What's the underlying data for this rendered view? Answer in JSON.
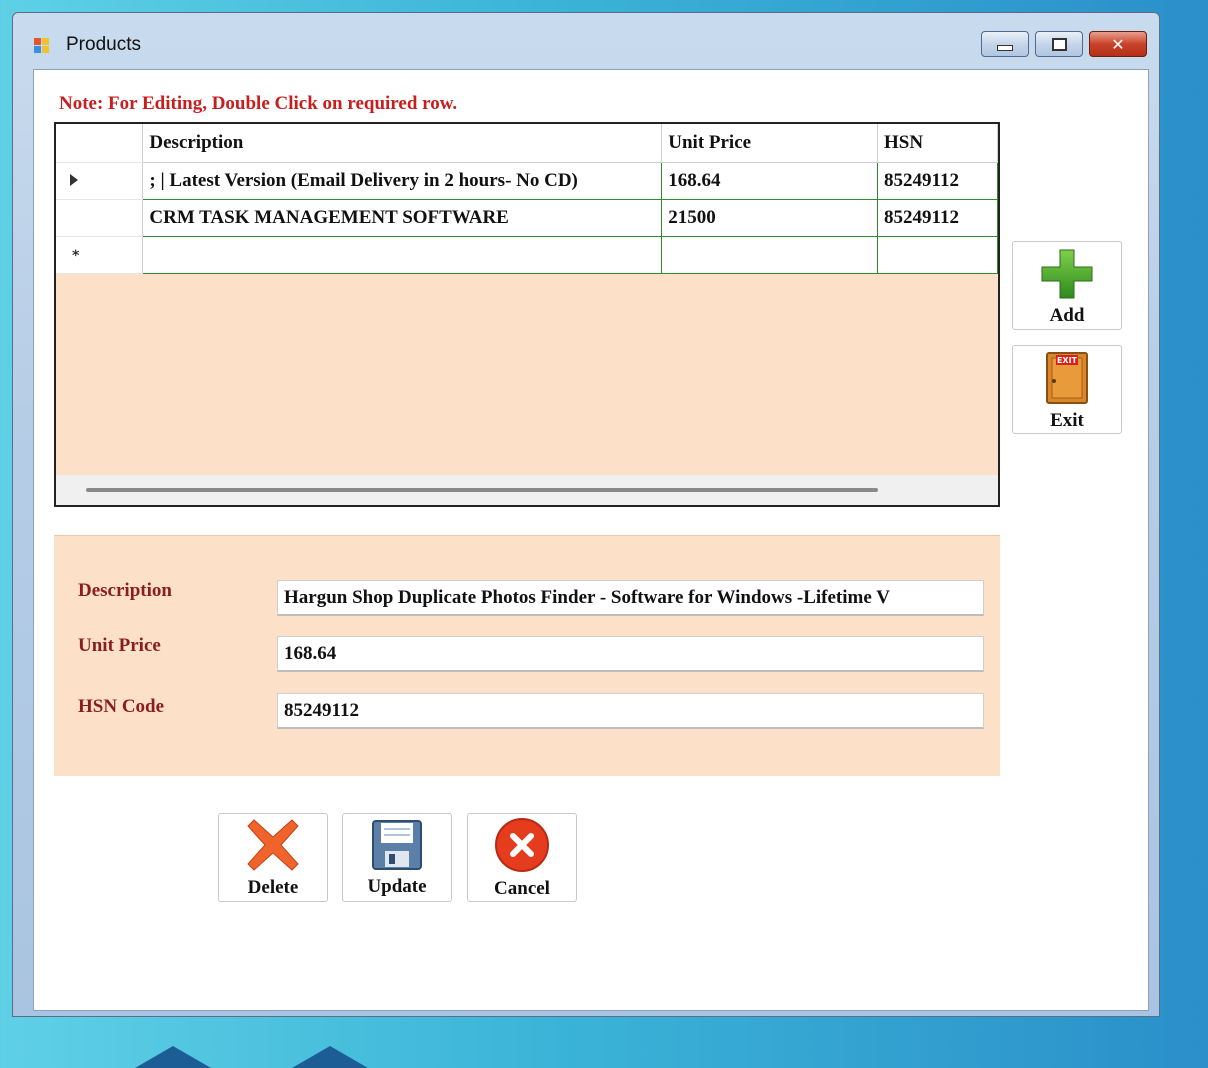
{
  "window": {
    "title": "Products",
    "controls": {
      "minimize": "minimize",
      "maximize": "maximize",
      "close": "close"
    }
  },
  "note": "Note: For Editing, Double Click on required row.",
  "grid": {
    "headers": [
      "Description",
      "Unit Price",
      "HSN"
    ],
    "rows": [
      {
        "indicator": "current",
        "description": "; | Latest Version (Email Delivery in 2 hours- No CD)",
        "unit_price": "168.64",
        "hsn": "85249112"
      },
      {
        "indicator": "",
        "description": "CRM TASK MANAGEMENT SOFTWARE",
        "unit_price": "21500",
        "hsn": "85249112"
      },
      {
        "indicator": "new",
        "description": "",
        "unit_price": "",
        "hsn": ""
      }
    ],
    "background_color": "#FDE0C8",
    "row_border_color": "#2E8B2E"
  },
  "side_buttons": {
    "add": {
      "label": "Add",
      "icon": "green-plus-icon"
    },
    "exit": {
      "label": "Exit",
      "icon": "exit-door-icon"
    }
  },
  "form": {
    "description": {
      "label": "Description",
      "value": "Hargun Shop Duplicate Photos Finder - Software for Windows -Lifetime V"
    },
    "unit_price": {
      "label": "Unit Price",
      "value": "168.64"
    },
    "hsn_code": {
      "label": "HSN Code",
      "value": "85249112"
    },
    "label_color": "#8B1D1D"
  },
  "actions": {
    "delete": {
      "label": "Delete",
      "icon": "red-x-icon"
    },
    "update": {
      "label": "Update",
      "icon": "floppy-disk-icon"
    },
    "cancel": {
      "label": "Cancel",
      "icon": "cancel-circle-icon"
    }
  },
  "colors": {
    "note": "#C81E1E",
    "panel": "#FDE0C8"
  }
}
